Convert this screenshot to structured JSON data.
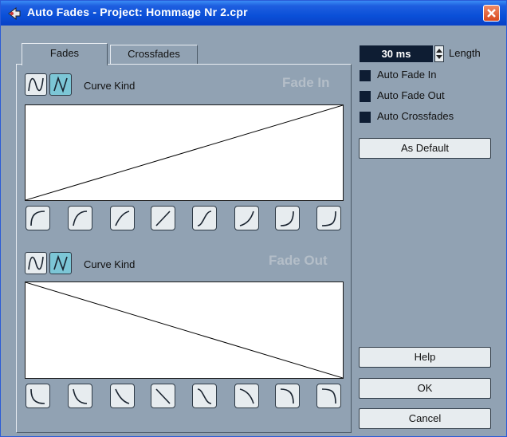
{
  "window": {
    "title": "Auto Fades - Project: Hommage Nr 2.cpr"
  },
  "tabs": [
    {
      "label": "Fades",
      "active": true
    },
    {
      "label": "Crossfades",
      "active": false
    }
  ],
  "fade_in": {
    "title": "Fade In",
    "curve_kind_label": "Curve Kind",
    "curve_kind_selected": "linear"
  },
  "fade_out": {
    "title": "Fade Out",
    "curve_kind_label": "Curve Kind",
    "curve_kind_selected": "linear"
  },
  "length": {
    "value": "30 ms",
    "label": "Length"
  },
  "options": [
    {
      "label": "Auto Fade In",
      "checked": false
    },
    {
      "label": "Auto Fade Out",
      "checked": false
    },
    {
      "label": "Auto Crossfades",
      "checked": false
    }
  ],
  "buttons": {
    "as_default": "As Default",
    "help": "Help",
    "ok": "OK",
    "cancel": "Cancel"
  },
  "icons": {
    "app": "cubase-icon",
    "close": "close-icon",
    "spline": "spline-curve-icon",
    "linear": "linear-curve-icon",
    "spinner": "spin-arrows-icon"
  }
}
